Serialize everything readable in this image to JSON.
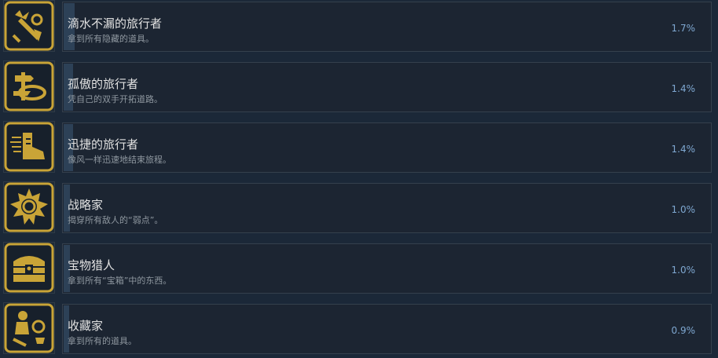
{
  "achievements": [
    {
      "title": "滴水不漏的旅行者",
      "description": "拿到所有隐藏的道具。",
      "percent": "1.7%",
      "percent_value": 1.7,
      "icon": "sword-relic-icon"
    },
    {
      "title": "孤傲的旅行者",
      "description": "凭自己的双手开拓道路。",
      "percent": "1.4%",
      "percent_value": 1.4,
      "icon": "signpost-icon"
    },
    {
      "title": "迅捷的旅行者",
      "description": "像风一样迅速地结束旅程。",
      "percent": "1.4%",
      "percent_value": 1.4,
      "icon": "winged-boot-icon"
    },
    {
      "title": "战略家",
      "description": "揭穿所有敌人的“弱点”。",
      "percent": "1.0%",
      "percent_value": 1.0,
      "icon": "sun-crest-icon"
    },
    {
      "title": "宝物猎人",
      "description": "拿到所有“宝箱”中的东西。",
      "percent": "1.0%",
      "percent_value": 1.0,
      "icon": "treasure-chest-icon"
    },
    {
      "title": "收藏家",
      "description": "拿到所有的道具。",
      "percent": "0.9%",
      "percent_value": 0.9,
      "icon": "collection-icon"
    }
  ],
  "colors": {
    "icon_gold": "#c9a437",
    "icon_bg": "#17202b",
    "progress_fill": "#2d4157"
  }
}
